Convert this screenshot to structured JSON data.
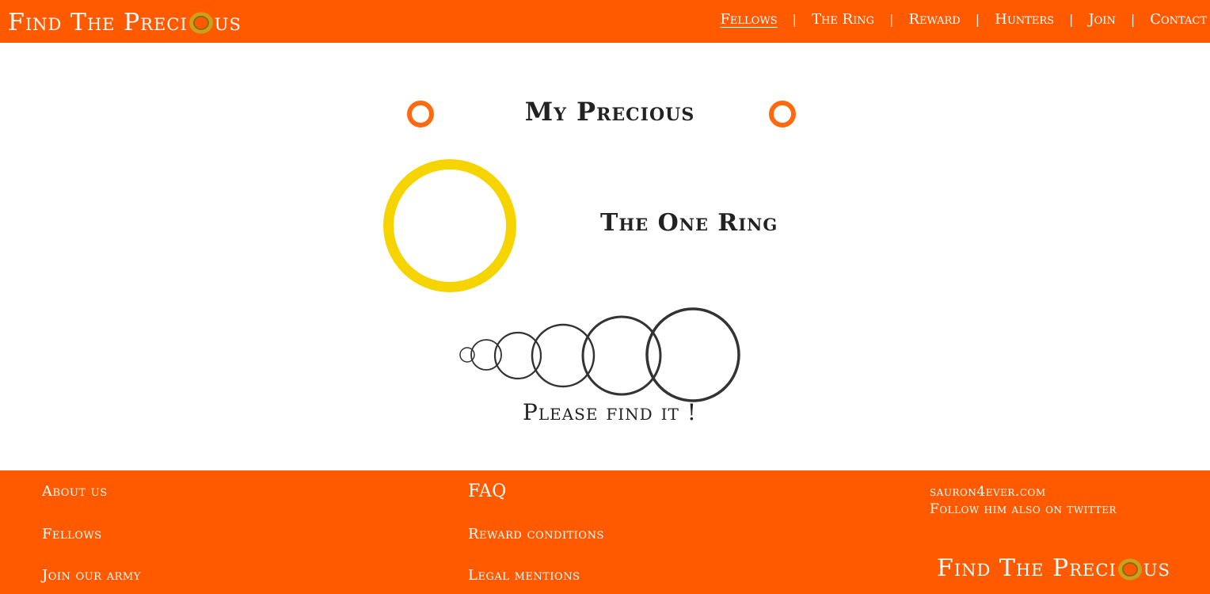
{
  "header": {
    "brand_prefix": "Find The Preci",
    "brand_suffix": "us",
    "nav": [
      {
        "label": "Fellows"
      },
      {
        "label": "The Ring"
      },
      {
        "label": "Reward"
      },
      {
        "label": "Hunters"
      },
      {
        "label": "Join"
      },
      {
        "label": "Contact"
      }
    ],
    "separator": "|",
    "active_nav": "Fellows"
  },
  "main": {
    "title": "My Precious",
    "ring_name": "The One Ring",
    "tagline": "Please find it !"
  },
  "footer": {
    "about": "About us",
    "fellows": "Fellows",
    "join": "Join our army",
    "faq": "FAQ",
    "reward_conditions": "Reward conditions",
    "legal": "Legal mentions",
    "contact_site": "sauron4ever.com",
    "contact_twitter": "Follow him also on twitter",
    "brand_prefix": "Find The Preci",
    "brand_suffix": "us"
  },
  "colors": {
    "accent": "#ff5a00",
    "ring_gold": "#f5d400",
    "orange_dot": "#ff6a10",
    "circle_stroke": "#333333"
  },
  "icons": [
    "ring-icon",
    "orange-ring-icon",
    "gold-ring-icon",
    "nested-circles-icon"
  ]
}
